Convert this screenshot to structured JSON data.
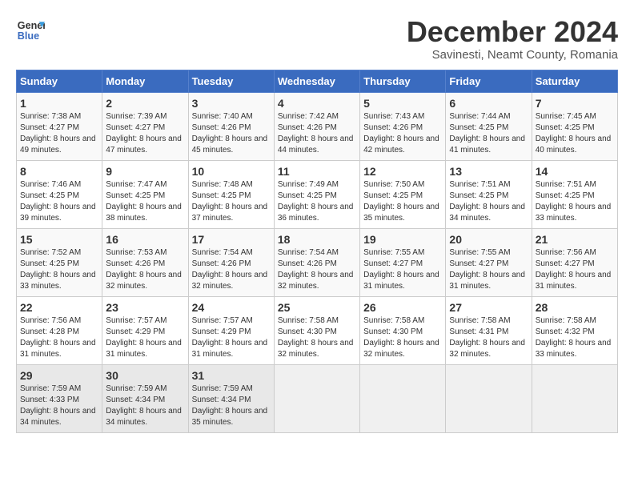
{
  "header": {
    "logo_line1": "General",
    "logo_line2": "Blue",
    "month": "December 2024",
    "location": "Savinesti, Neamt County, Romania"
  },
  "weekdays": [
    "Sunday",
    "Monday",
    "Tuesday",
    "Wednesday",
    "Thursday",
    "Friday",
    "Saturday"
  ],
  "weeks": [
    [
      {
        "day": "1",
        "sr": "Sunrise: 7:38 AM",
        "ss": "Sunset: 4:27 PM",
        "dl": "Daylight: 8 hours and 49 minutes."
      },
      {
        "day": "2",
        "sr": "Sunrise: 7:39 AM",
        "ss": "Sunset: 4:27 PM",
        "dl": "Daylight: 8 hours and 47 minutes."
      },
      {
        "day": "3",
        "sr": "Sunrise: 7:40 AM",
        "ss": "Sunset: 4:26 PM",
        "dl": "Daylight: 8 hours and 45 minutes."
      },
      {
        "day": "4",
        "sr": "Sunrise: 7:42 AM",
        "ss": "Sunset: 4:26 PM",
        "dl": "Daylight: 8 hours and 44 minutes."
      },
      {
        "day": "5",
        "sr": "Sunrise: 7:43 AM",
        "ss": "Sunset: 4:26 PM",
        "dl": "Daylight: 8 hours and 42 minutes."
      },
      {
        "day": "6",
        "sr": "Sunrise: 7:44 AM",
        "ss": "Sunset: 4:25 PM",
        "dl": "Daylight: 8 hours and 41 minutes."
      },
      {
        "day": "7",
        "sr": "Sunrise: 7:45 AM",
        "ss": "Sunset: 4:25 PM",
        "dl": "Daylight: 8 hours and 40 minutes."
      }
    ],
    [
      {
        "day": "8",
        "sr": "Sunrise: 7:46 AM",
        "ss": "Sunset: 4:25 PM",
        "dl": "Daylight: 8 hours and 39 minutes."
      },
      {
        "day": "9",
        "sr": "Sunrise: 7:47 AM",
        "ss": "Sunset: 4:25 PM",
        "dl": "Daylight: 8 hours and 38 minutes."
      },
      {
        "day": "10",
        "sr": "Sunrise: 7:48 AM",
        "ss": "Sunset: 4:25 PM",
        "dl": "Daylight: 8 hours and 37 minutes."
      },
      {
        "day": "11",
        "sr": "Sunrise: 7:49 AM",
        "ss": "Sunset: 4:25 PM",
        "dl": "Daylight: 8 hours and 36 minutes."
      },
      {
        "day": "12",
        "sr": "Sunrise: 7:50 AM",
        "ss": "Sunset: 4:25 PM",
        "dl": "Daylight: 8 hours and 35 minutes."
      },
      {
        "day": "13",
        "sr": "Sunrise: 7:51 AM",
        "ss": "Sunset: 4:25 PM",
        "dl": "Daylight: 8 hours and 34 minutes."
      },
      {
        "day": "14",
        "sr": "Sunrise: 7:51 AM",
        "ss": "Sunset: 4:25 PM",
        "dl": "Daylight: 8 hours and 33 minutes."
      }
    ],
    [
      {
        "day": "15",
        "sr": "Sunrise: 7:52 AM",
        "ss": "Sunset: 4:25 PM",
        "dl": "Daylight: 8 hours and 33 minutes."
      },
      {
        "day": "16",
        "sr": "Sunrise: 7:53 AM",
        "ss": "Sunset: 4:26 PM",
        "dl": "Daylight: 8 hours and 32 minutes."
      },
      {
        "day": "17",
        "sr": "Sunrise: 7:54 AM",
        "ss": "Sunset: 4:26 PM",
        "dl": "Daylight: 8 hours and 32 minutes."
      },
      {
        "day": "18",
        "sr": "Sunrise: 7:54 AM",
        "ss": "Sunset: 4:26 PM",
        "dl": "Daylight: 8 hours and 32 minutes."
      },
      {
        "day": "19",
        "sr": "Sunrise: 7:55 AM",
        "ss": "Sunset: 4:27 PM",
        "dl": "Daylight: 8 hours and 31 minutes."
      },
      {
        "day": "20",
        "sr": "Sunrise: 7:55 AM",
        "ss": "Sunset: 4:27 PM",
        "dl": "Daylight: 8 hours and 31 minutes."
      },
      {
        "day": "21",
        "sr": "Sunrise: 7:56 AM",
        "ss": "Sunset: 4:27 PM",
        "dl": "Daylight: 8 hours and 31 minutes."
      }
    ],
    [
      {
        "day": "22",
        "sr": "Sunrise: 7:56 AM",
        "ss": "Sunset: 4:28 PM",
        "dl": "Daylight: 8 hours and 31 minutes."
      },
      {
        "day": "23",
        "sr": "Sunrise: 7:57 AM",
        "ss": "Sunset: 4:29 PM",
        "dl": "Daylight: 8 hours and 31 minutes."
      },
      {
        "day": "24",
        "sr": "Sunrise: 7:57 AM",
        "ss": "Sunset: 4:29 PM",
        "dl": "Daylight: 8 hours and 31 minutes."
      },
      {
        "day": "25",
        "sr": "Sunrise: 7:58 AM",
        "ss": "Sunset: 4:30 PM",
        "dl": "Daylight: 8 hours and 32 minutes."
      },
      {
        "day": "26",
        "sr": "Sunrise: 7:58 AM",
        "ss": "Sunset: 4:30 PM",
        "dl": "Daylight: 8 hours and 32 minutes."
      },
      {
        "day": "27",
        "sr": "Sunrise: 7:58 AM",
        "ss": "Sunset: 4:31 PM",
        "dl": "Daylight: 8 hours and 32 minutes."
      },
      {
        "day": "28",
        "sr": "Sunrise: 7:58 AM",
        "ss": "Sunset: 4:32 PM",
        "dl": "Daylight: 8 hours and 33 minutes."
      }
    ],
    [
      {
        "day": "29",
        "sr": "Sunrise: 7:59 AM",
        "ss": "Sunset: 4:33 PM",
        "dl": "Daylight: 8 hours and 34 minutes."
      },
      {
        "day": "30",
        "sr": "Sunrise: 7:59 AM",
        "ss": "Sunset: 4:34 PM",
        "dl": "Daylight: 8 hours and 34 minutes."
      },
      {
        "day": "31",
        "sr": "Sunrise: 7:59 AM",
        "ss": "Sunset: 4:34 PM",
        "dl": "Daylight: 8 hours and 35 minutes."
      },
      null,
      null,
      null,
      null
    ]
  ]
}
